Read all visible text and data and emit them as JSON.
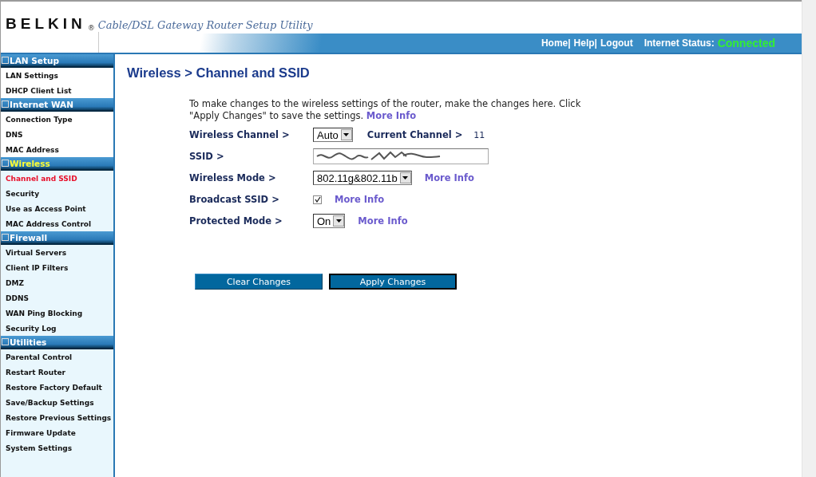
{
  "header": {
    "logo": "BELKIN",
    "registered": "®",
    "tagline": "Cable/DSL Gateway Router Setup Utility",
    "nav": [
      "Home|",
      "Help|",
      "Logout"
    ],
    "status_label": "Internet Status:",
    "status_value": "Connected"
  },
  "sidebar": [
    {
      "title": "LAN Setup",
      "selected": false,
      "items": [
        {
          "label": "LAN Settings",
          "selected": false
        },
        {
          "label": "DHCP Client List",
          "selected": false
        }
      ]
    },
    {
      "title": "Internet WAN",
      "selected": false,
      "items": [
        {
          "label": "Connection Type",
          "selected": false
        },
        {
          "label": "DNS",
          "selected": false
        },
        {
          "label": "MAC Address",
          "selected": false
        }
      ]
    },
    {
      "title": "Wireless",
      "selected": true,
      "items": [
        {
          "label": "Channel and SSID",
          "selected": true
        },
        {
          "label": "Security",
          "selected": false
        },
        {
          "label": "Use as Access Point",
          "selected": false
        },
        {
          "label": "MAC Address Control",
          "selected": false
        }
      ]
    },
    {
      "title": "Firewall",
      "selected": false,
      "items": [
        {
          "label": "Virtual Servers",
          "selected": false
        },
        {
          "label": "Client IP Filters",
          "selected": false
        },
        {
          "label": "DMZ",
          "selected": false
        },
        {
          "label": "DDNS",
          "selected": false
        },
        {
          "label": "WAN Ping Blocking",
          "selected": false
        },
        {
          "label": "Security Log",
          "selected": false
        }
      ]
    },
    {
      "title": "Utilities",
      "selected": false,
      "items": [
        {
          "label": "Parental Control",
          "selected": false
        },
        {
          "label": "Restart Router",
          "selected": false
        },
        {
          "label": "Restore Factory Default",
          "selected": false
        },
        {
          "label": "Save/Backup Settings",
          "selected": false
        },
        {
          "label": "Restore Previous Settings",
          "selected": false
        },
        {
          "label": "Firmware Update",
          "selected": false
        },
        {
          "label": "System Settings",
          "selected": false
        }
      ]
    }
  ],
  "page_title": "Wireless > Channel and SSID",
  "intro": {
    "text": "To make changes to the wireless settings of the router, make the changes here. Click \"Apply Changes\" to save the settings.",
    "link": "More Info"
  },
  "form": [
    {
      "kind": "select",
      "label": "Wireless Channel >",
      "value": "Auto",
      "extra_label": "Current Channel >",
      "extra_value": "11"
    },
    {
      "kind": "text",
      "label": "SSID >"
    },
    {
      "kind": "select",
      "label": "Wireless Mode >",
      "value": "802.11g&802.11b",
      "link": "More Info"
    },
    {
      "kind": "checkbox",
      "label": "Broadcast SSID >",
      "checked": true,
      "link": "More Info"
    },
    {
      "kind": "select",
      "label": "Protected Mode >",
      "value": "On",
      "link": "More Info"
    }
  ],
  "buttons": [
    {
      "label": "Clear Changes",
      "focused": false
    },
    {
      "label": "Apply Changes",
      "focused": true
    }
  ]
}
